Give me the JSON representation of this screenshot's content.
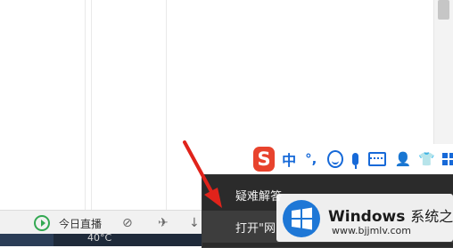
{
  "status_bar": {
    "live_label": "今日直播"
  },
  "taskbar": {
    "temperature": "40°C"
  },
  "ime": {
    "logo_letter": "S",
    "mode_label": "中",
    "punct_label": "°,"
  },
  "context_menu": {
    "items": [
      {
        "label": "疑难解答"
      },
      {
        "label": "打开\"网"
      }
    ]
  },
  "watermark": {
    "brand": "Windows",
    "brand_cn": "系统之家",
    "url": "www.bjjmlv.com"
  },
  "colors": {
    "sogou_red": "#e8432d",
    "ime_blue": "#1669d8",
    "menu_bg": "#2b2b2b",
    "arrow_red": "#e0231b"
  }
}
